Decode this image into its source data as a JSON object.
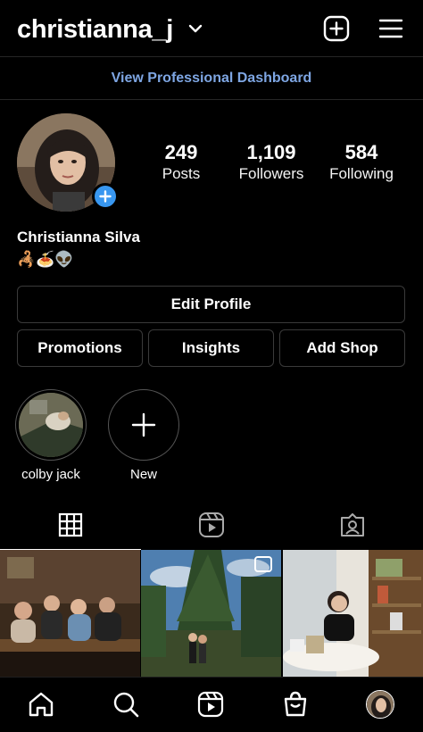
{
  "header": {
    "username": "christianna_j",
    "icons": {
      "chevron": "chevron-down-icon",
      "create": "plus-square-icon",
      "menu": "hamburger-menu-icon"
    }
  },
  "dashboard": {
    "label": "View Professional Dashboard",
    "color": "#7ea6e3"
  },
  "profile": {
    "full_name": "Christianna Silva",
    "bio": "🦂🍝👽",
    "stats": [
      {
        "value": "249",
        "label": "Posts"
      },
      {
        "value": "1,109",
        "label": "Followers"
      },
      {
        "value": "584",
        "label": "Following"
      }
    ]
  },
  "buttons": {
    "edit_profile": "Edit Profile",
    "promotions": "Promotions",
    "insights": "Insights",
    "add_shop": "Add Shop"
  },
  "highlights": [
    {
      "label": "colby jack"
    },
    {
      "label": "New"
    }
  ],
  "tabs": [
    {
      "icon": "grid-icon",
      "active": true
    },
    {
      "icon": "reels-icon",
      "active": false
    },
    {
      "icon": "tagged-icon",
      "active": false
    }
  ],
  "bottom_nav": [
    {
      "icon": "home-icon"
    },
    {
      "icon": "search-icon"
    },
    {
      "icon": "reels-icon"
    },
    {
      "icon": "shop-icon"
    },
    {
      "icon": "profile-avatar"
    }
  ],
  "colors": {
    "background": "#000000",
    "accent_blue": "#3897f0",
    "border": "#3a3a3a"
  }
}
